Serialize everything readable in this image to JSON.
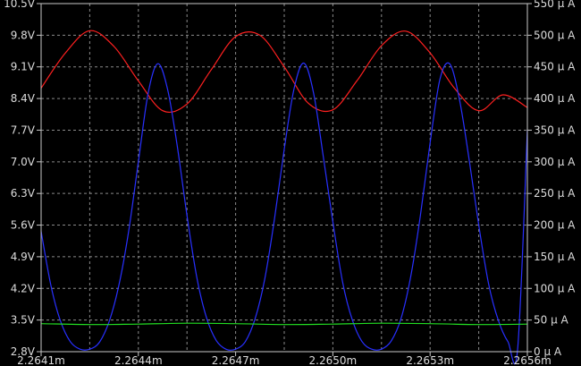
{
  "chart_data": {
    "type": "line",
    "left_axis": {
      "min": 2.8,
      "max": 10.5,
      "ticks": [
        "10.5V",
        "9.8V",
        "9.1V",
        "8.4V",
        "7.7V",
        "7.0V",
        "6.3V",
        "5.6V",
        "4.9V",
        "4.2V",
        "3.5V",
        "2.8V"
      ]
    },
    "right_axis": {
      "min": 0,
      "max": 550,
      "ticks": [
        "550 μ A",
        "500 μ A",
        "450 μ A",
        "400 μ A",
        "350 μ A",
        "300 μ A",
        "250 μ A",
        "200 μ A",
        "150 μ A",
        "100 μ A",
        "50 μ A",
        "0 μ A"
      ]
    },
    "x_axis": {
      "min": 0,
      "max": 1,
      "ticks": [
        {
          "x": 0.0,
          "label": "2.2641m"
        },
        {
          "x": 0.2,
          "label": "2.2644m"
        },
        {
          "x": 0.4,
          "label": "2.2647m"
        },
        {
          "x": 0.6,
          "label": "2.2650m"
        },
        {
          "x": 0.8,
          "label": "2.2653m"
        },
        {
          "x": 1.0,
          "label": "2.2656m"
        }
      ]
    },
    "grid": true,
    "colors": {
      "background": "#000000",
      "grid": "#8a8a8a",
      "axis": "#c8c8c8",
      "text": "#dcdcdc"
    },
    "series": [
      {
        "color": "#ff2020",
        "axis": "left",
        "x": [
          0.0,
          0.05,
          0.1,
          0.15,
          0.2,
          0.25,
          0.3,
          0.35,
          0.4,
          0.45,
          0.5,
          0.55,
          0.6,
          0.65,
          0.7,
          0.75,
          0.8,
          0.85,
          0.9,
          0.95,
          1.0
        ],
        "y": [
          8.63,
          9.41,
          9.9,
          9.55,
          8.79,
          8.13,
          8.28,
          9.04,
          9.77,
          9.8,
          9.1,
          8.29,
          8.15,
          8.8,
          9.57,
          9.89,
          9.41,
          8.63,
          8.13,
          8.48,
          8.2
        ]
      },
      {
        "color": "#2830ff",
        "axis": "right",
        "x": [
          0.0,
          0.02,
          0.04,
          0.06,
          0.08,
          0.1,
          0.12,
          0.14,
          0.16,
          0.18,
          0.2,
          0.22,
          0.24,
          0.26,
          0.28,
          0.3,
          0.32,
          0.34,
          0.36,
          0.38,
          0.4,
          0.42,
          0.44,
          0.46,
          0.48,
          0.5,
          0.52,
          0.54,
          0.56,
          0.58,
          0.6,
          0.62,
          0.64,
          0.66,
          0.68,
          0.7,
          0.72,
          0.74,
          0.76,
          0.78,
          0.8,
          0.82,
          0.84,
          0.86,
          0.88,
          0.9,
          0.92,
          0.94,
          0.96,
          0.98,
          1.0
        ],
        "y": [
          190,
          105,
          48,
          16,
          4,
          4,
          15,
          48,
          105,
          190,
          300,
          408,
          455,
          415,
          325,
          215,
          118,
          54,
          18,
          4,
          4,
          16,
          52,
          115,
          210,
          320,
          415,
          456,
          410,
          310,
          205,
          110,
          50,
          16,
          4,
          4,
          17,
          52,
          118,
          215,
          330,
          430,
          455,
          400,
          305,
          200,
          108,
          50,
          16,
          4,
          350
        ]
      },
      {
        "color": "#22dd22",
        "axis": "left",
        "x": [
          0.0,
          0.1,
          0.2,
          0.3,
          0.4,
          0.5,
          0.6,
          0.7,
          0.8,
          0.9,
          1.0
        ],
        "y": [
          3.42,
          3.4,
          3.41,
          3.43,
          3.42,
          3.4,
          3.41,
          3.43,
          3.42,
          3.4,
          3.41
        ]
      }
    ]
  }
}
